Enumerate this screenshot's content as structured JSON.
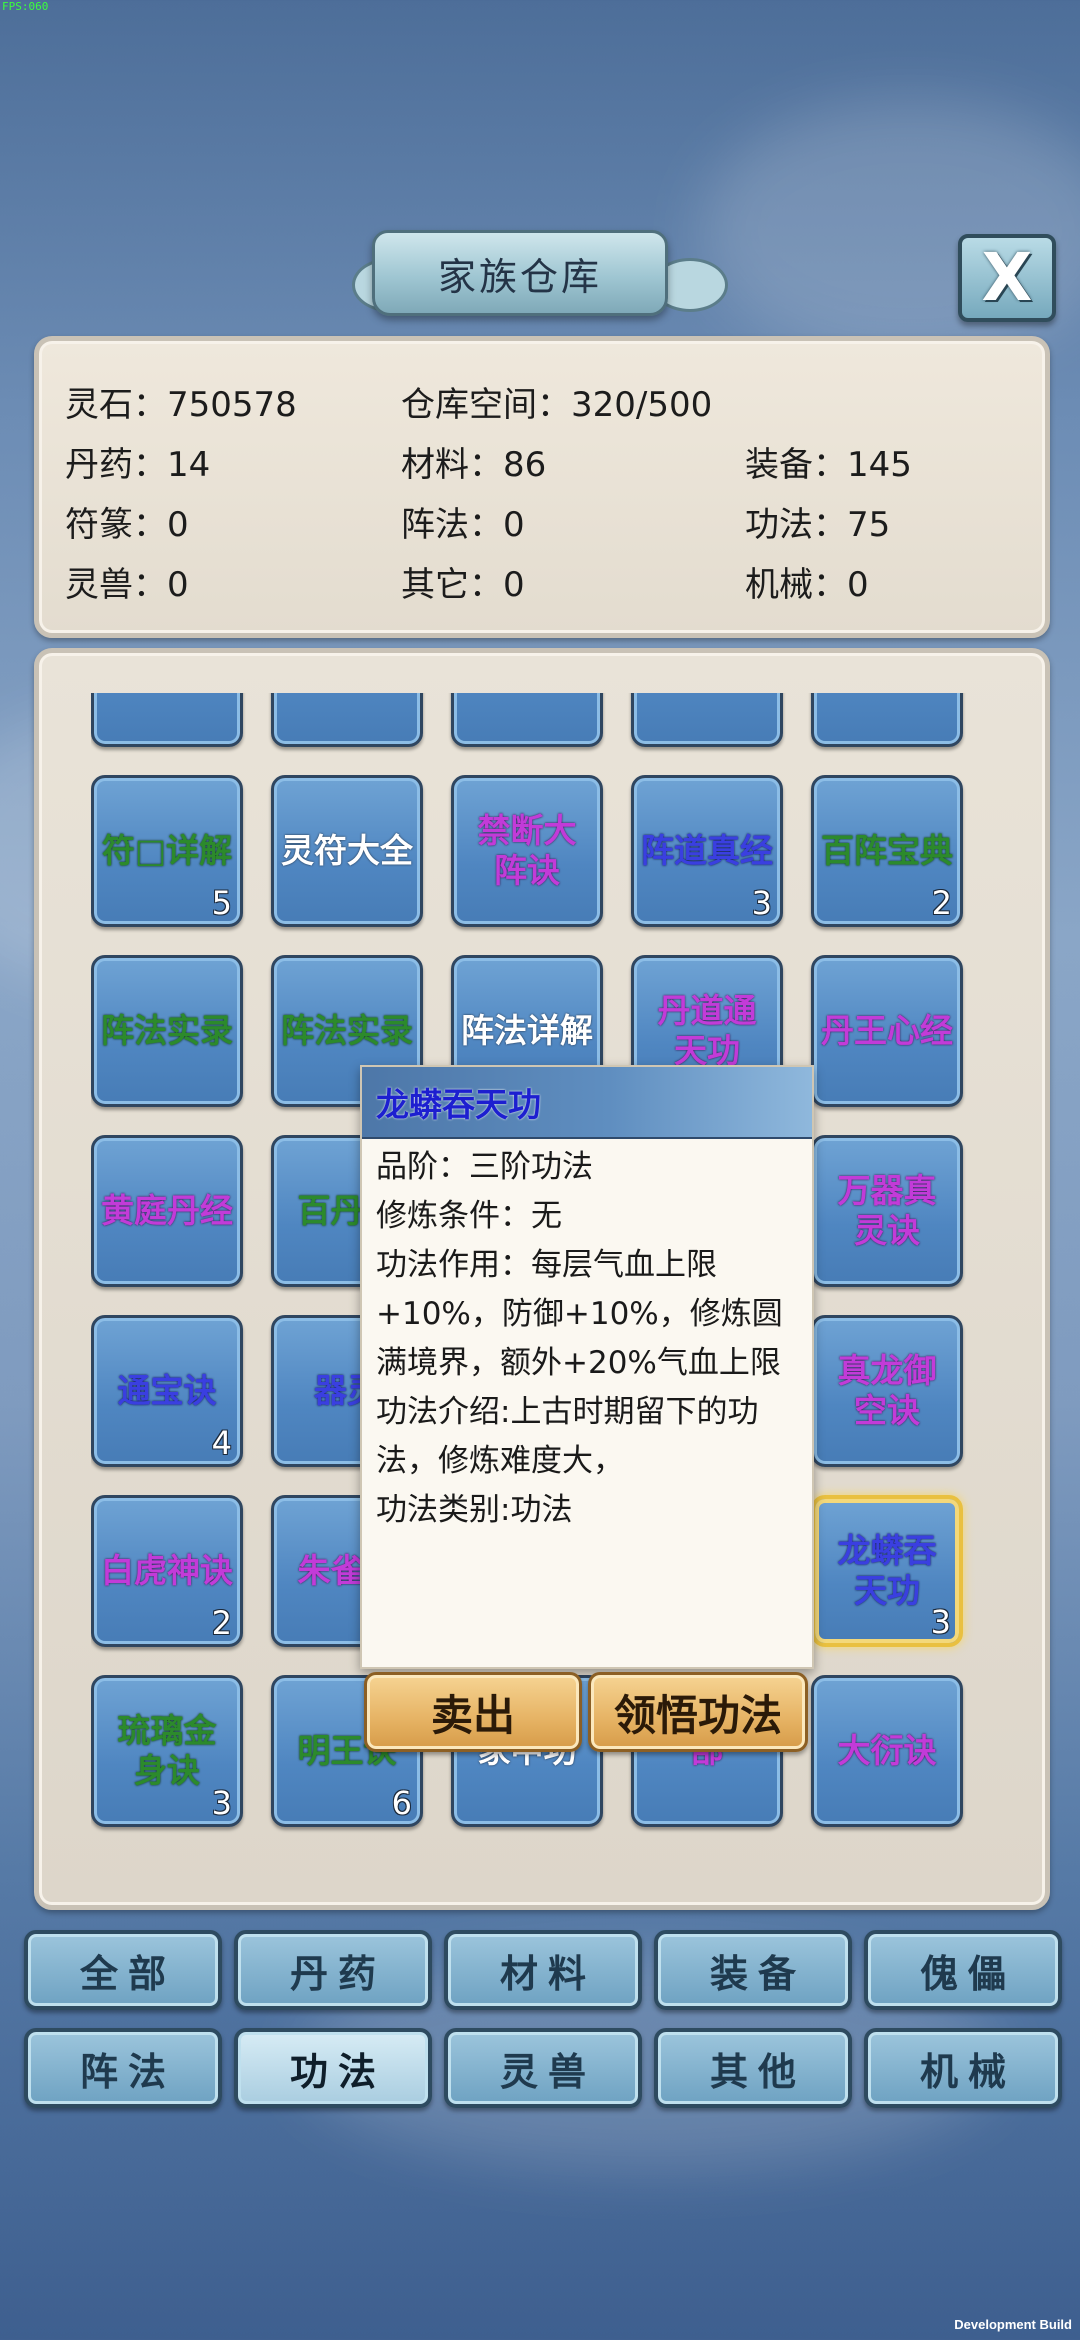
{
  "debug": {
    "fps": "FPS:060",
    "build": "Development Build"
  },
  "header": {
    "title": "家族仓库",
    "close_label": "X"
  },
  "stats": [
    {
      "label": "灵石：750578"
    },
    {
      "label": "仓库空间：320/500"
    },
    {
      "label": "丹药：14"
    },
    {
      "label": "材料：86"
    },
    {
      "label": "装备：145"
    },
    {
      "label": "符篆：0"
    },
    {
      "label": "阵法：0"
    },
    {
      "label": "功法：75"
    },
    {
      "label": "灵兽：0"
    },
    {
      "label": "其它：0"
    },
    {
      "label": "机械：0"
    }
  ],
  "grid": {
    "items": [
      {
        "name": "",
        "count": ""
      },
      {
        "name": "",
        "count": ""
      },
      {
        "name": "",
        "count": ""
      },
      {
        "name": "",
        "count": ""
      },
      {
        "name": "",
        "count": ""
      },
      {
        "name": "符□详解",
        "count": "5"
      },
      {
        "name": "灵符大全",
        "count": ""
      },
      {
        "name": "禁断大阵诀",
        "count": ""
      },
      {
        "name": "阵道真经",
        "count": "3"
      },
      {
        "name": "百阵宝典",
        "count": "2"
      },
      {
        "name": "阵法实录",
        "count": ""
      },
      {
        "name": "阵法实录",
        "count": ""
      },
      {
        "name": "阵法详解",
        "count": ""
      },
      {
        "name": "丹道通天功",
        "count": ""
      },
      {
        "name": "丹王心经",
        "count": ""
      },
      {
        "name": "黄庭丹经",
        "count": ""
      },
      {
        "name": "百丹宝",
        "count": ""
      },
      {
        "name": "",
        "count": ""
      },
      {
        "name": "",
        "count": ""
      },
      {
        "name": "万器真灵诀",
        "count": ""
      },
      {
        "name": "通宝诀",
        "count": "4"
      },
      {
        "name": "器灵",
        "count": ""
      },
      {
        "name": "",
        "count": ""
      },
      {
        "name": "",
        "count": ""
      },
      {
        "name": "真龙御空诀",
        "count": ""
      },
      {
        "name": "白虎神诀",
        "count": "2"
      },
      {
        "name": "朱雀神",
        "count": ""
      },
      {
        "name": "",
        "count": ""
      },
      {
        "name": "",
        "count": ""
      },
      {
        "name": "龙蟒吞天功",
        "count": "3"
      },
      {
        "name": "琉璃金身诀",
        "count": "3"
      },
      {
        "name": "明王诀",
        "count": "6"
      },
      {
        "name": "家中功",
        "count": ""
      },
      {
        "name": "部",
        "count": ""
      },
      {
        "name": "大衍诀",
        "count": ""
      }
    ]
  },
  "popup": {
    "title": "龙蟒吞天功",
    "lines": [
      "品阶：三阶功法",
      "修炼条件：无",
      "功法作用：每层气血上限+10%，防御+10%，修炼圆满境界，额外+20%气血上限",
      "功法介绍:上古时期留下的功法，修炼难度大，",
      "功法类别:功法"
    ],
    "sell_label": "卖出",
    "learn_label": "领悟功法"
  },
  "tabs": [
    {
      "label": "全部"
    },
    {
      "label": "丹药"
    },
    {
      "label": "材料"
    },
    {
      "label": "装备"
    },
    {
      "label": "傀儡"
    },
    {
      "label": "阵法"
    },
    {
      "label": "功法"
    },
    {
      "label": "灵兽"
    },
    {
      "label": "其他"
    },
    {
      "label": "机械"
    }
  ],
  "active_tab": "功法",
  "colors": {
    "green_text": "#2c8a2c",
    "purple_text": "#c23bd8",
    "blue_text": "#3a3fe0",
    "white_text": "#ffffff",
    "selected_border": "#e9c040"
  }
}
